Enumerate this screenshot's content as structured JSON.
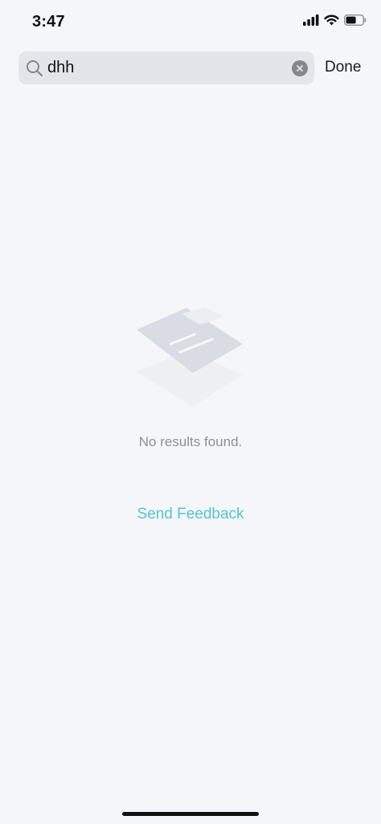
{
  "status_bar": {
    "time": "3:47",
    "icons": [
      "cellular-signal-icon",
      "wifi-icon",
      "battery-icon"
    ]
  },
  "search": {
    "value": "dhh",
    "done_label": "Done"
  },
  "empty_state": {
    "message": "No results found.",
    "illustration": "empty-documents-illustration"
  },
  "feedback": {
    "label": "Send Feedback"
  },
  "colors": {
    "background": "#f5f6f9",
    "accent": "#53c4d2",
    "muted_text": "#8d9097",
    "search_field": "#e4e5ea"
  }
}
